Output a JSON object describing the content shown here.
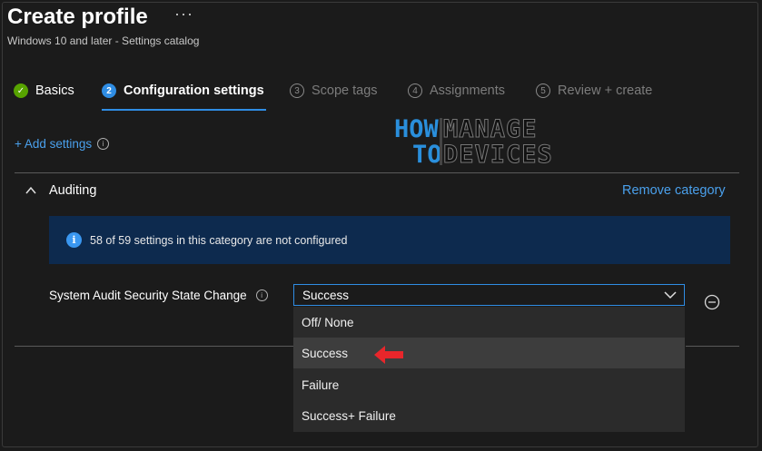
{
  "header": {
    "title": "Create profile",
    "more_label": "···",
    "subtitle": "Windows 10 and later - Settings catalog"
  },
  "steps": [
    {
      "number": "✓",
      "label": "Basics",
      "state": "done"
    },
    {
      "number": "2",
      "label": "Configuration settings",
      "state": "active"
    },
    {
      "number": "3",
      "label": "Scope tags",
      "state": "pending"
    },
    {
      "number": "4",
      "label": "Assignments",
      "state": "pending"
    },
    {
      "number": "5",
      "label": "Review + create",
      "state": "pending"
    }
  ],
  "add_settings": {
    "label": "+ Add settings",
    "info": "i"
  },
  "watermark": {
    "line1_left": "HOW",
    "line1_right": "MANAGE",
    "line2_left": "TO",
    "line2_right": "DEVICES"
  },
  "category": {
    "title": "Auditing",
    "remove_label": "Remove category",
    "banner_icon": "i",
    "banner_text": "58 of 59 settings in this category are not configured"
  },
  "setting": {
    "label": "System Audit Security State Change",
    "info": "i",
    "selected_value": "Success",
    "options": [
      "Off/ None",
      "Success",
      "Failure",
      "Success+ Failure"
    ],
    "highlighted_option_index": 1
  },
  "colors": {
    "accent": "#2f8de4",
    "link": "#4aa0ec",
    "success": "#57a300",
    "arrow": "#e8262b",
    "banner_bg": "#0d2a4e"
  }
}
